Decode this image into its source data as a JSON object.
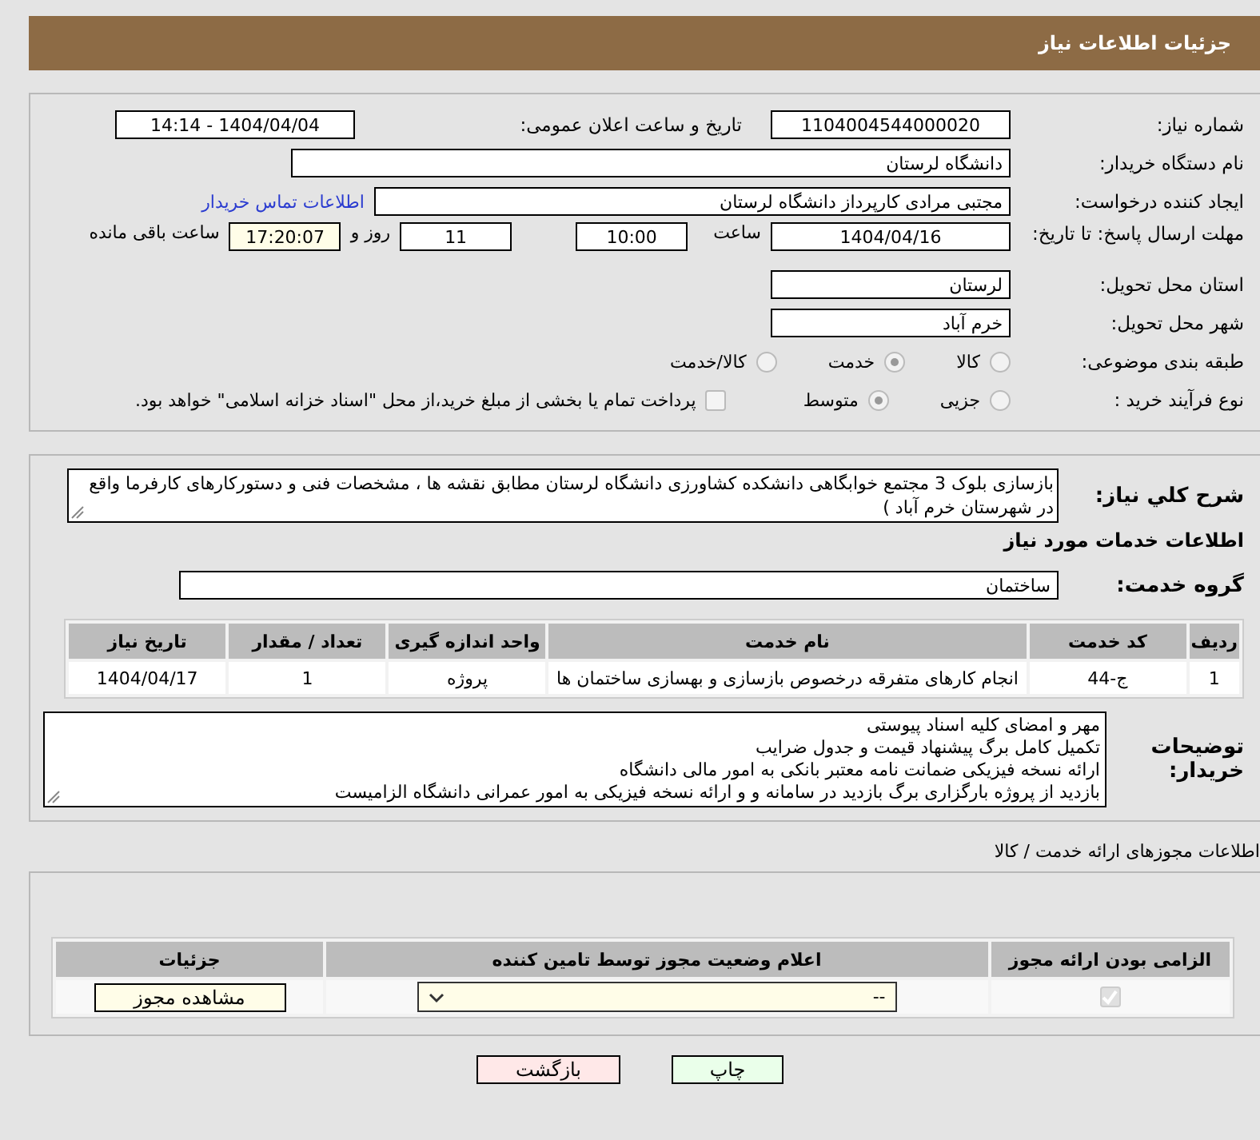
{
  "header": {
    "title": "جزئیات اطلاعات نیاز"
  },
  "details": {
    "need_number": {
      "label": "شماره نیاز:",
      "value": "1104004544000020"
    },
    "announce": {
      "label": "تاریخ و ساعت اعلان عمومی:",
      "value": "1404/04/04 - 14:14"
    },
    "buyer": {
      "label": "نام دستگاه خریدار:",
      "value": "دانشگاه لرستان"
    },
    "requester": {
      "label": "ایجاد کننده درخواست:",
      "value": "مجتبی مرادی کارپرداز دانشگاه لرستان",
      "link": "اطلاعات تماس خریدار"
    },
    "deadline": {
      "label": "مهلت ارسال پاسخ: تا تاریخ:",
      "date": "1404/04/16",
      "time_label": "ساعت",
      "time": "10:00",
      "days": "11",
      "days_label": "روز و",
      "remaining": "17:20:07",
      "remaining_label": "ساعت باقی مانده"
    },
    "province": {
      "label": "استان محل تحویل:",
      "value": "لرستان"
    },
    "city": {
      "label": "شهر محل تحویل:",
      "value": "خرم آباد"
    },
    "category": {
      "label": "طبقه بندی موضوعی:",
      "options": [
        {
          "label": "کالا",
          "selected": false
        },
        {
          "label": "خدمت",
          "selected": true
        },
        {
          "label": "کالا/خدمت",
          "selected": false
        }
      ]
    },
    "process": {
      "label": "نوع فرآیند خرید :",
      "options": [
        {
          "label": "جزیی",
          "selected": false
        },
        {
          "label": "متوسط",
          "selected": true
        }
      ],
      "payment": {
        "label": "پرداخت تمام یا بخشی از مبلغ خرید،از محل \"اسناد خزانه اسلامی\" خواهد بود.",
        "checked": false
      }
    }
  },
  "need": {
    "summary_label": "شرح کلي نياز:",
    "summary": "بازسازی بلوک 3 مجتمع خوابگاهی دانشکده کشاورزی دانشگاه لرستان مطابق نقشه ها ، مشخصات فنی و دستورکارهای کارفرما واقع در شهرستان خرم آباد )",
    "services_title": "اطلاعات خدمات مورد نیاز",
    "group_label": "گروه خدمت:",
    "group": "ساختمان",
    "table": {
      "columns": [
        "ردیف",
        "کد خدمت",
        "نام خدمت",
        "واحد اندازه گیری",
        "تعداد / مقدار",
        "تاریخ نیاز"
      ],
      "rows": [
        [
          "1",
          "ج-44",
          "انجام کارهای متفرقه درخصوص بازسازی و بهسازی ساختمان ها",
          "پروژه",
          "1",
          "1404/04/17"
        ]
      ]
    },
    "notes_label": "توضیحات خریدار:",
    "notes": "مهر و امضای کلیه اسناد پیوستی\nتکمیل کامل برگ پیشنهاد قیمت و جدول ضرایب\nارائه نسخه فیزیکی ضمانت نامه معتبر بانکی به امور مالی دانشگاه\nبازدید از پروژه بارگزاری برگ بازدید در سامانه و و ارائه نسخه فیزیکی به امور عمرانی دانشگاه الزامیست"
  },
  "permits": {
    "title": "اطلاعات مجوزهای ارائه خدمت / کالا",
    "columns": [
      "الزامی بودن ارائه مجوز",
      "اعلام وضعیت مجوز توسط تامین کننده",
      "جزئیات"
    ],
    "rows": [
      {
        "required": true,
        "status": "--",
        "action": "مشاهده مجوز"
      }
    ]
  },
  "buttons": [
    {
      "label": "چاپ",
      "kind": "print"
    },
    {
      "label": "بازگشت",
      "kind": "back"
    }
  ]
}
